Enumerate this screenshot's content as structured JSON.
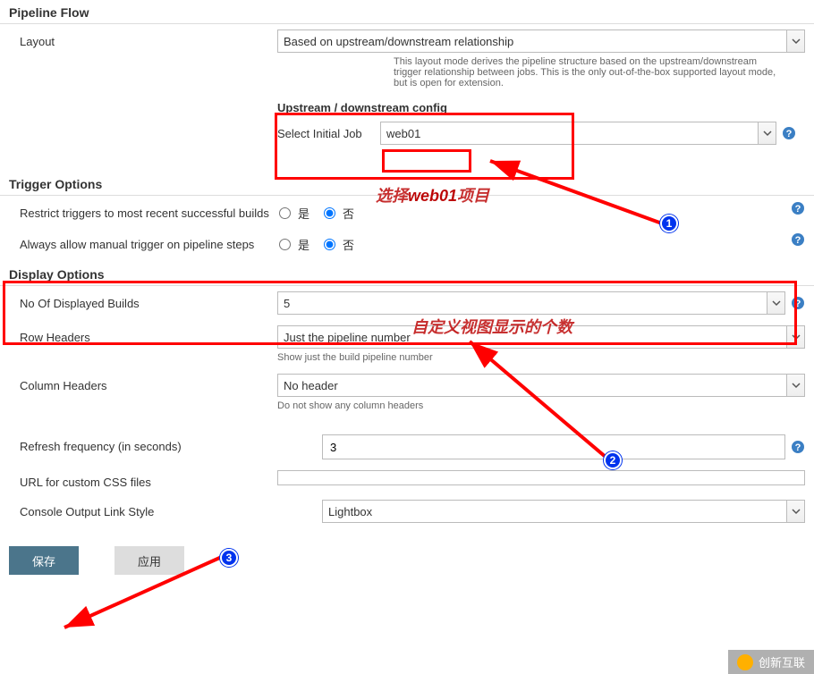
{
  "sections": {
    "pipelineFlow": "Pipeline Flow",
    "triggerOptions": "Trigger Options",
    "displayOptions": "Display Options"
  },
  "labels": {
    "layout": "Layout",
    "selectInitialJob": "Select Initial Job",
    "restrictTriggers": "Restrict triggers to most recent successful builds",
    "alwaysAllow": "Always allow manual trigger on pipeline steps",
    "noOfDisplayed": "No Of Displayed Builds",
    "rowHeaders": "Row Headers",
    "columnHeaders": "Column Headers",
    "refreshFreq": "Refresh frequency (in seconds)",
    "urlCss": "URL for custom CSS files",
    "consoleLink": "Console Output Link Style"
  },
  "values": {
    "layout": "Based on upstream/downstream relationship",
    "layoutHelp": "This layout mode derives the pipeline structure based on the upstream/downstream trigger relationship between jobs. This is the only out-of-the-box supported layout mode, but is open for extension.",
    "upstreamTitle": "Upstream / downstream config",
    "initialJob": "web01",
    "noOfDisplayed": "5",
    "rowHeaders": "Just the pipeline number",
    "rowHeadersHelp": "Show just the build pipeline number",
    "columnHeaders": "No header",
    "columnHeadersHelp": "Do not show any column headers",
    "refreshFreq": "3",
    "urlCss": "",
    "consoleLink": "Lightbox"
  },
  "radio": {
    "yes": "是",
    "no": "否"
  },
  "buttons": {
    "save": "保存",
    "apply": "应用"
  },
  "annotations": {
    "selectWeb01": "选择web01项目",
    "customCount": "自定义视图显示的个数",
    "badge1": "1",
    "badge2": "2",
    "badge3": "3"
  },
  "watermark": "创新互联"
}
